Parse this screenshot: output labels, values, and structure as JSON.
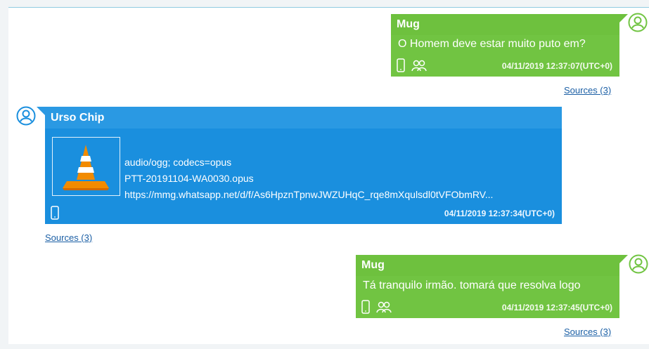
{
  "messages": [
    {
      "sender": "Mug",
      "text": "O Homem deve estar muito puto em?",
      "timestamp": "04/11/2019 12:37:07(UTC+0)",
      "sources": "Sources (3)",
      "direction": "outgoing",
      "color": "#71c442",
      "icons": [
        "phone-icon",
        "group-icon"
      ]
    },
    {
      "sender": "Urso Chip",
      "attachment": {
        "mime": "audio/ogg; codecs=opus",
        "filename": "PTT-20191104-WA0030.opus",
        "url": "https://mmg.whatsapp.net/d/f/As6HpznTpnwJWZUHqC_rqe8mXqulsdl0tVFObmRV...",
        "thumbnail": "vlc-cone-icon"
      },
      "timestamp": "04/11/2019 12:37:34(UTC+0)",
      "sources": "Sources (3)",
      "direction": "incoming",
      "color": "#1a8fde",
      "icons": [
        "phone-icon"
      ]
    },
    {
      "sender": "Mug",
      "text": "Tá tranquilo irmão. tomará que resolva logo",
      "timestamp": "04/11/2019 12:37:45(UTC+0)",
      "sources": "Sources (3)",
      "direction": "outgoing",
      "color": "#71c442",
      "icons": [
        "phone-icon",
        "group-icon"
      ]
    }
  ]
}
